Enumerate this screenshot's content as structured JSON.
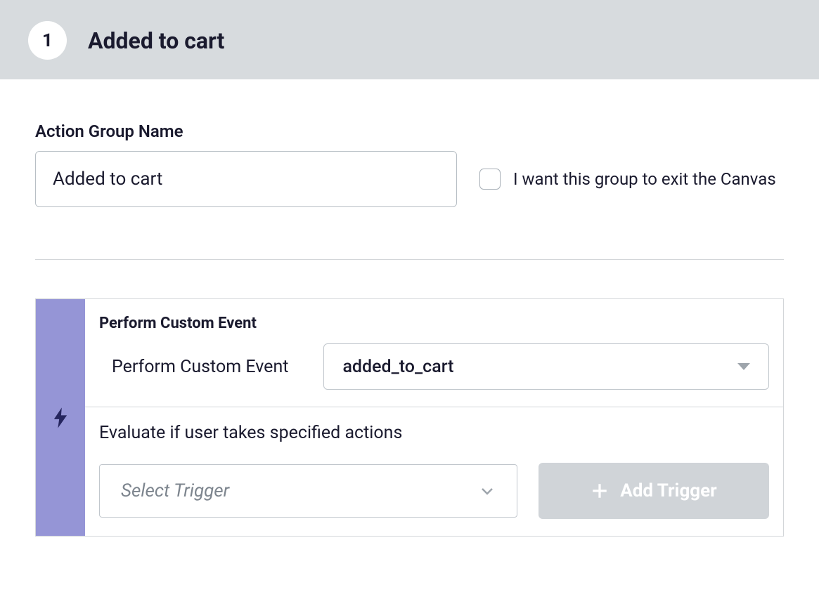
{
  "header": {
    "step_number": "1",
    "step_title": "Added to cart"
  },
  "form": {
    "name_label": "Action Group Name",
    "name_value": "Added to cart",
    "exit_checkbox_label": "I want this group to exit the Canvas"
  },
  "event": {
    "section_title": "Perform Custom Event",
    "row_label": "Perform Custom Event",
    "selected_event": "added_to_cart",
    "evaluate_label": "Evaluate if user takes specified actions",
    "trigger_placeholder": "Select Trigger",
    "add_trigger_label": "Add Trigger"
  }
}
